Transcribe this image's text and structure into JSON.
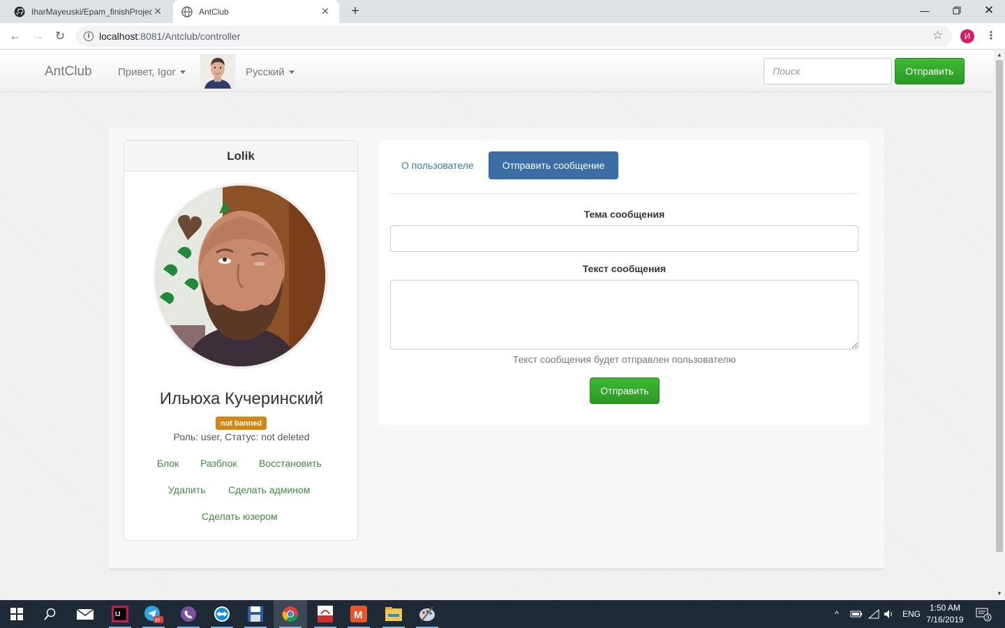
{
  "browser": {
    "tabs": [
      {
        "title": "IharMayeuski/Epam_finishProject",
        "active": false
      },
      {
        "title": "AntClub",
        "active": true
      }
    ],
    "url_host": "localhost",
    "url_rest": ":8081/Antclub/controller",
    "profile_initial": "И"
  },
  "navbar": {
    "brand": "AntClub",
    "greeting": "Привет, Igor",
    "language": "Русский",
    "search_placeholder": "Поиск",
    "search_button": "Отправить"
  },
  "profile": {
    "login": "Lolik",
    "full_name": "Ильюха Кучеринский",
    "ban_status": "not banned",
    "role_line": "Роль: user, Статус: not deleted",
    "actions": [
      "Блок",
      "Разблок",
      "Восстановить",
      "Удалить",
      "Сделать админом",
      "Сделать юзером"
    ]
  },
  "message": {
    "tab_about": "О пользователе",
    "tab_send": "Отправить сообщение",
    "subject_label": "Тема сообщения",
    "subject_value": "",
    "body_label": "Текст сообщения",
    "body_value": "",
    "help_text": "Текст сообщения будет отправлен пользователю",
    "submit": "Отправить"
  },
  "taskbar": {
    "language": "ENG",
    "time": "1:50 AM",
    "date": "7/16/2019",
    "notifications": "3",
    "telegram_badge": "35",
    "apps": [
      "start-icon",
      "search-icon",
      "mail-icon",
      "intellij-icon",
      "telegram-icon",
      "viber-icon",
      "teamviewer-icon",
      "save-icon",
      "chrome-icon",
      "pdf-icon",
      "mail-ru-icon",
      "file-explorer-icon",
      "paint-icon"
    ]
  }
}
